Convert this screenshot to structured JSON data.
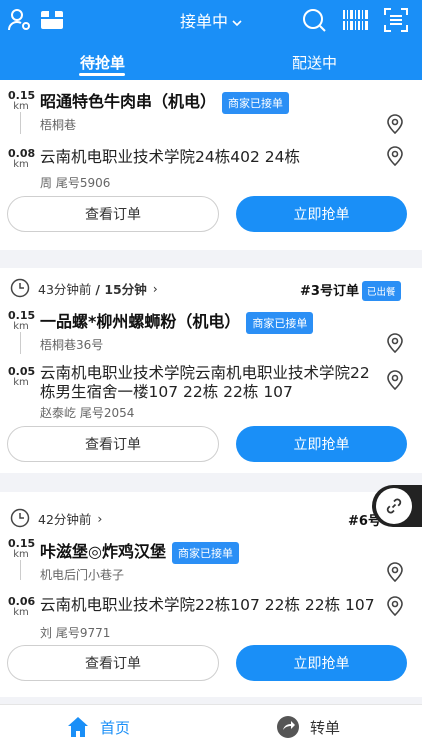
{
  "header": {
    "title": "接单中",
    "icons": {
      "left1": "user-settings-icon",
      "left2": "box-icon",
      "right1": "search-icon",
      "right2": "barcode-scan-icon",
      "right3": "scan-frame-icon"
    }
  },
  "tabs": [
    {
      "label": "待抢单",
      "active": true
    },
    {
      "label": "配送中",
      "active": false
    }
  ],
  "orders": [
    {
      "time_ago": "",
      "duration": "",
      "order_no": "",
      "out_badge": "",
      "pickup": {
        "dist": "0.15",
        "unit": "km",
        "name": "昭通特色牛肉串（机电）",
        "badge": "商家已接单",
        "address": "梧桐巷"
      },
      "dropoff": {
        "dist": "0.08",
        "unit": "km",
        "address": "云南机电职业技术学院24栋402 24栋",
        "customer": "周  尾号5906"
      },
      "view_label": "查看订单",
      "grab_label": "立即抢单"
    },
    {
      "time_ago": "43分钟前",
      "duration": "/ 15分钟",
      "order_no": "#3号订单",
      "out_badge": "已出餐",
      "pickup": {
        "dist": "0.15",
        "unit": "km",
        "name": "一品螺*柳州螺蛳粉（机电）",
        "badge": "商家已接单",
        "address": "梧桐巷36号"
      },
      "dropoff": {
        "dist": "0.05",
        "unit": "km",
        "address": "云南机电职业技术学院云南机电职业技术学院22栋男生宿舍一楼107 22栋 22栋 107",
        "customer": "赵泰屹  尾号2054"
      },
      "view_label": "查看订单",
      "grab_label": "立即抢单"
    },
    {
      "time_ago": "42分钟前",
      "duration": "",
      "order_no": "#6号",
      "out_badge": "",
      "pickup": {
        "dist": "0.15",
        "unit": "km",
        "name": "咔滋堡◎炸鸡汉堡",
        "badge": "商家已接单",
        "address": "机电后门小巷子"
      },
      "dropoff": {
        "dist": "0.06",
        "unit": "km",
        "address": "云南机电职业技术学院22栋107 22栋 22栋 107",
        "customer": "刘  尾号9771"
      },
      "view_label": "查看订单",
      "grab_label": "立即抢单"
    }
  ],
  "bottom_nav": [
    {
      "label": "首页",
      "icon": "home-icon",
      "active": true
    },
    {
      "label": "转单",
      "icon": "transfer-icon",
      "active": false
    }
  ],
  "colors": {
    "primary": "#1a8ff7",
    "badge": "#2b8ff5"
  }
}
